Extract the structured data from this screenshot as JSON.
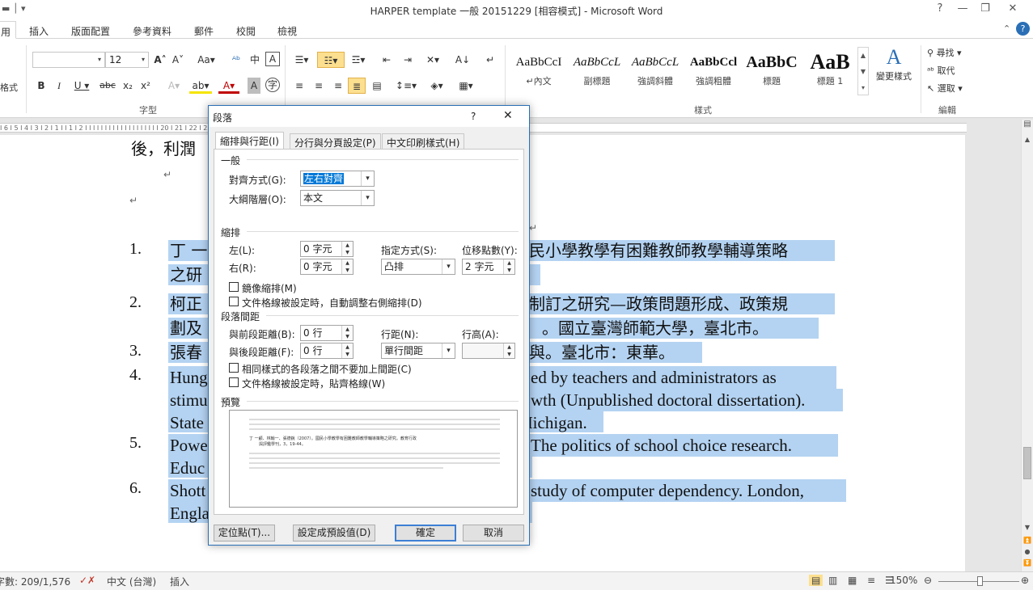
{
  "window": {
    "title": "HARPER template 一般 20151229 [相容模式] - Microsoft Word"
  },
  "tabs": [
    "用",
    "插入",
    "版面配置",
    "參考資料",
    "郵件",
    "校閱",
    "檢視"
  ],
  "ribbon": {
    "font_name": "",
    "font_size": "12",
    "group_font": "字型",
    "group_style": "樣式",
    "group_edit": "編輯",
    "partial_left": "格式",
    "styles": [
      {
        "sample": "AaBbCcI",
        "name": "↵內文"
      },
      {
        "sample": "AaBbCcL",
        "name": "副標題"
      },
      {
        "sample": "AaBbCcL",
        "name": "強調斜體"
      },
      {
        "sample": "AaBbCcl",
        "name": "強調粗體"
      },
      {
        "sample": "AaBbC",
        "name": "標題"
      },
      {
        "sample": "AaB",
        "name": "標題 1"
      }
    ],
    "change_styles": "變更樣式",
    "find": "尋找",
    "replace": "取代",
    "select": "選取"
  },
  "ruler": {
    "text": "I 6 I 5 I 4 I 3 I 2 I 1 I      I 1 I 2 I     I     I     I     I     I     I     I     I     I     I     I     I     I     I     I     I     I     I 20 I 21 I 22 I 23 I 24 I 25 I 26 I 27 I 28 I 29 I 30 I 31 I 32 I 33 I 34 I 35 I 36 I 37 I 38 I 39 I 40 I 41 I 42 I"
  },
  "document": {
    "line_top": "後，利潤",
    "refs": [
      {
        "num": "1.",
        "lines": [
          "丁 一",
          "之研"
        ],
        "right": [
          "民小學教學有困難教師教學輔導策略",
          ""
        ]
      },
      {
        "num": "2.",
        "lines": [
          "柯正",
          "劃及"
        ],
        "right": [
          "制訂之研究—政策問題形成、政策規",
          "。國立臺灣師範大學，臺北市。"
        ]
      },
      {
        "num": "3.",
        "lines": [
          "張春"
        ],
        "right": [
          "與。臺北市：東華。"
        ]
      },
      {
        "num": "4.",
        "lines": [
          "Hung",
          "stimu",
          "State"
        ],
        "right": [
          "ed by teachers and administrators as",
          "wth (Unpublished doctoral dissertation).",
          "Michigan."
        ]
      },
      {
        "num": "5.",
        "lines": [
          "Powe",
          "Educ"
        ],
        "right": [
          "The politics of school choice research.",
          ""
        ]
      },
      {
        "num": "6.",
        "lines": [
          "Shott",
          "Engla"
        ],
        "right": [
          "study of computer dependency. London,",
          ""
        ]
      }
    ]
  },
  "status": {
    "words": "字數: 209/1,576",
    "language": "中文 (台灣)",
    "mode": "插入",
    "zoom": "150%"
  },
  "dialog": {
    "title": "段落",
    "help": "?",
    "tabs": [
      "縮排與行距(I)",
      "分行與分頁設定(P)",
      "中文印刷樣式(H)"
    ],
    "general": {
      "section": "一般",
      "alignment_label": "對齊方式(G):",
      "alignment_value": "左右對齊",
      "outline_label": "大綱階層(O):",
      "outline_value": "本文"
    },
    "indent": {
      "section": "縮排",
      "left_label": "左(L):",
      "left_value": "0 字元",
      "right_label": "右(R):",
      "right_value": "0 字元",
      "special_label": "指定方式(S):",
      "special_value": "凸排",
      "by_label": "位移點數(Y):",
      "by_value": "2 字元",
      "mirror": "鏡像縮排(M)",
      "auto_adjust": "文件格線被設定時，自動調整右側縮排(D)"
    },
    "spacing": {
      "section": "段落間距",
      "before_label": "與前段距離(B):",
      "before_value": "0 行",
      "after_label": "與後段距離(F):",
      "after_value": "0 行",
      "line_label": "行距(N):",
      "line_value": "單行間距",
      "at_label": "行高(A):",
      "at_value": "",
      "no_space": "相同樣式的各段落之間不要加上間距(C)",
      "snap_grid": "文件格線被設定時，貼齊格線(W)"
    },
    "preview": {
      "section": "預覽",
      "sample_text": "丁 一顧、林翰一、張德銳（2007）。國民小學教學有困難教師教學輔導策略之研究。教育行政",
      "sample_text2": "與評鑑學刊，3，19-44。"
    },
    "buttons": {
      "tabs": "定位點(T)...",
      "default": "設定成預設值(D)",
      "ok": "確定",
      "cancel": "取消"
    }
  }
}
